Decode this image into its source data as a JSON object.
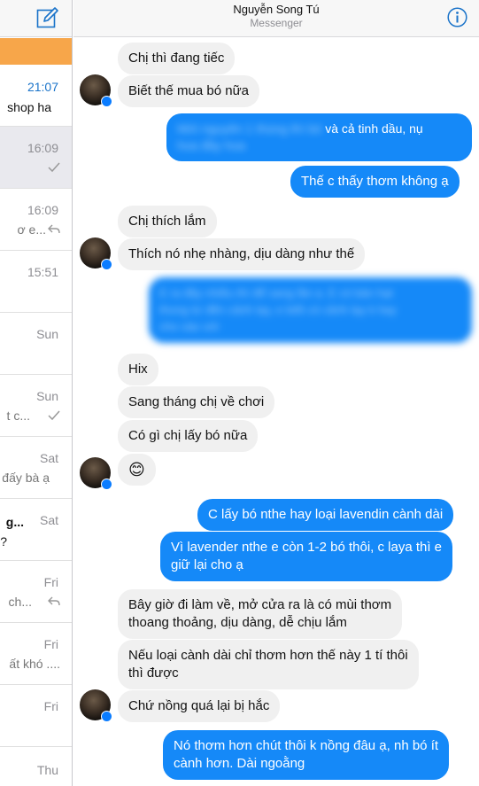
{
  "header": {
    "title": "Nguyễn Song Tú",
    "subtitle": "Messenger"
  },
  "conversations": [
    {
      "time": "21:07",
      "snippet": "shop ha",
      "style": "unread"
    },
    {
      "time": "16:09",
      "snippet": "",
      "status_icon": "check-icon",
      "style": "selected"
    },
    {
      "time": "16:09",
      "snippet": "ơ e...",
      "status_icon": "reply-icon"
    },
    {
      "time": "15:51",
      "snippet": ""
    },
    {
      "time": "Sun",
      "snippet": ""
    },
    {
      "time": "Sun",
      "snippet": "t c...",
      "status_icon": "check-icon"
    },
    {
      "time": "Sat",
      "snippet": "đấy bà ạ"
    },
    {
      "time": "Sat",
      "snippet": "g...",
      "snippet2": "?",
      "style": "dark"
    },
    {
      "time": "Fri",
      "snippet": "ch...",
      "status_icon": "reply-icon"
    },
    {
      "time": "Fri",
      "snippet": "ất khó ...."
    },
    {
      "time": "Fri",
      "snippet": ""
    },
    {
      "time": "Thu",
      "snippet": ""
    }
  ],
  "messages": [
    {
      "side": "in",
      "text": "Chị thì đang tiếc"
    },
    {
      "side": "in",
      "text": "Biết thế mua bó nữa"
    },
    {
      "side": "out",
      "text": "Mới nguyên 1 thùng thì bó",
      "text2": "và cả tinh dầu, nụ",
      "text3": "hoa đầy hoa",
      "blurred": true
    },
    {
      "side": "out",
      "text": "Thế c thấy thơm không ạ"
    },
    {
      "side": "in",
      "text": "Chị thích lắm"
    },
    {
      "side": "in",
      "text": "Thích nó nhẹ nhàng, dịu dàng như thế"
    },
    {
      "side": "out",
      "text": "E ra đây nhiều thì để sang lần a. E có bán hạt",
      "text2": "thong từ đến cảnh lạy, e biết có cảnh lạy k hay",
      "text3": "cho vào với",
      "blurred": true
    },
    {
      "side": "in",
      "text": "Hix"
    },
    {
      "side": "in",
      "text": "Sang tháng chị về chơi"
    },
    {
      "side": "in",
      "text": "Có gì chị lấy bó nữa"
    },
    {
      "side": "in",
      "text": "😊"
    },
    {
      "side": "out",
      "text": "C lấy bó nthe hay loại lavendin cành dài"
    },
    {
      "side": "out",
      "text": "Vì lavender nthe e còn 1-2 bó thôi, c laya thì e",
      "text2": "giữ lại cho ạ"
    },
    {
      "side": "in",
      "text": "Bây giờ đi làm về, mở cửa ra là có mùi thơm",
      "text2": "thoang thoảng, dịu dàng, dễ chịu lắm"
    },
    {
      "side": "in",
      "text": "Nếu loại cành dài chỉ thơm hơn thế này 1 tí thôi",
      "text2": "thì được"
    },
    {
      "side": "in",
      "text": "Chứ nồng quá lại bị hắc"
    },
    {
      "side": "out",
      "text": "Nó thơm hơn chút thôi k nồng đâu ạ, nh bó ít",
      "text2": "cành hơn. Dài ngoằng"
    }
  ],
  "colors": {
    "outgoing_bubble": "#1589f8",
    "incoming_bubble": "#f0f0f0",
    "accent": "#1a73c9",
    "banner": "#f7a64a"
  }
}
